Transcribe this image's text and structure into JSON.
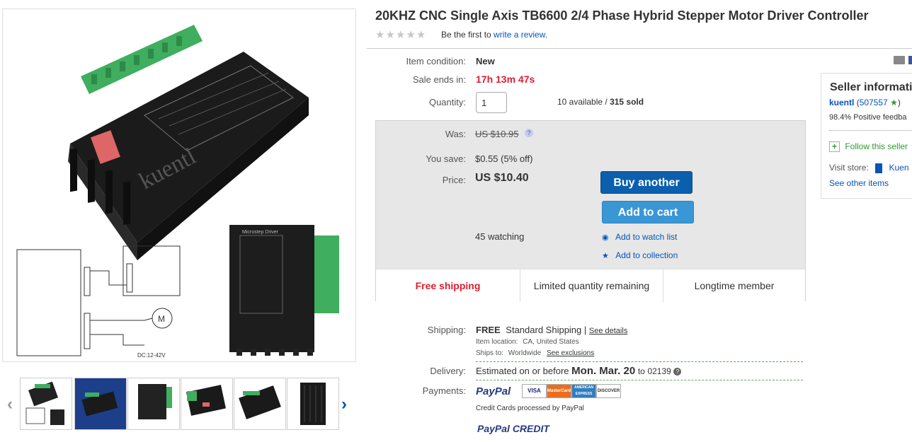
{
  "title": "20KHZ CNC Single Axis TB6600 2/4 Phase Hybrid Stepper Motor Driver Controller",
  "review": {
    "prefix": "Be the first to",
    "link": "write a review."
  },
  "condition": {
    "label": "Item condition:",
    "value": "New"
  },
  "sale_ends": {
    "label": "Sale ends in:",
    "value": "17h 13m 47s"
  },
  "quantity": {
    "label": "Quantity:",
    "value": "1",
    "available": "10 available / ",
    "sold": "315 sold"
  },
  "was": {
    "label": "Was:",
    "value": "US $10.95",
    "help": "?"
  },
  "you_save": {
    "label": "You save:",
    "value": "$0.55 (5% off)"
  },
  "price": {
    "label": "Price:",
    "value": "US $10.40"
  },
  "buttons": {
    "buy": "Buy another",
    "cart": "Add to cart"
  },
  "watching": "45 watching",
  "watch_link": "Add to watch list",
  "collection_link": "Add to collection",
  "badges": [
    "Free shipping",
    "Limited quantity remaining",
    "Longtime member"
  ],
  "shipping": {
    "label": "Shipping:",
    "free": "FREE",
    "method": "Standard Shipping |",
    "details": "See details",
    "location_label": "Item location:",
    "location": "CA, United States",
    "ships_label": "Ships to:",
    "ships": "Worldwide",
    "exclusions": "See exclusions"
  },
  "delivery": {
    "label": "Delivery:",
    "prefix": "Estimated on or before",
    "date": "Mon. Mar. 20",
    "to": "to",
    "zip": "02139"
  },
  "payments": {
    "label": "Payments:",
    "paypal": "PayPal",
    "cards": [
      "VISA",
      "MasterCard",
      "AMERICAN EXPRESS",
      "DISCOVER"
    ],
    "note": "Credit Cards processed by PayPal",
    "credit": "PayPal CREDIT"
  },
  "seller": {
    "heading": "Seller informatio",
    "name": "kuentl",
    "feedback": "507557",
    "positive": "98.4% Positive feedba",
    "follow": "Follow this seller",
    "store_label": "Visit store:",
    "store": "Kuen",
    "other": "See other items"
  },
  "colors": {
    "link": "#0654ba",
    "sale": "#dd1e31",
    "buy_button": "#0b5fad",
    "cart_button": "#3a97d6",
    "free_ship": "#dd1e31"
  },
  "icons": [
    "star-icon",
    "help-icon",
    "eye-icon",
    "star-blue-icon",
    "info-icon",
    "plus-icon",
    "store-icon",
    "mail-icon",
    "chevron-left-icon",
    "chevron-right-icon"
  ]
}
